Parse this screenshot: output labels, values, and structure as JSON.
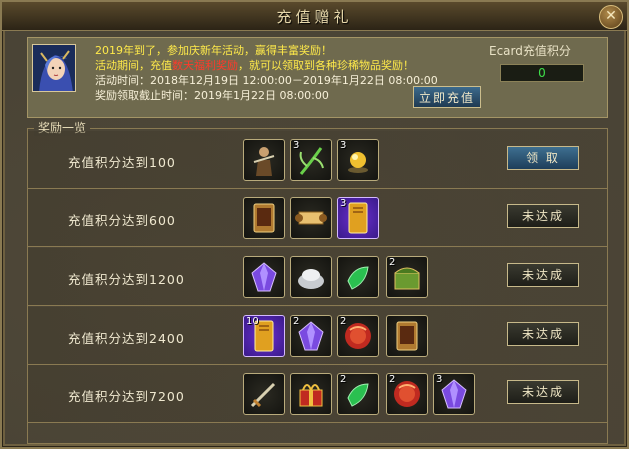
{
  "window": {
    "title": "充值赠礼"
  },
  "notice": {
    "line1": "2019年到了，参加庆新年活动，赢得丰富奖励！",
    "line2_prefix": "活动期间，充值",
    "line2_highlight": "数天福利奖励",
    "line2_suffix": "，就可以领取到各种珍稀物品奖励！",
    "line3": "活动时间：2018年12月19日 12:00:00－2019年1月22日 08:00:00",
    "line4": "奖励领取截止时间：2019年1月22日 08:00:00"
  },
  "ecard": {
    "label": "Ecard充值积分",
    "value": "0"
  },
  "recharge_button": "立即充值",
  "section_title": "奖励一览",
  "tiers": [
    {
      "label": "充值积分达到100",
      "action": "领 取",
      "items": [
        {
          "icon": "warrior-figure-icon",
          "count": ""
        },
        {
          "icon": "herb-icon",
          "count": "3"
        },
        {
          "icon": "golden-orb-icon",
          "count": "3"
        }
      ]
    },
    {
      "label": "充值积分达到600",
      "action": "未达成",
      "items": [
        {
          "icon": "skill-book-icon",
          "count": ""
        },
        {
          "icon": "scroll-icon",
          "count": ""
        },
        {
          "icon": "gold-book-icon",
          "count": "3"
        }
      ]
    },
    {
      "label": "充值积分达到1200",
      "action": "未达成",
      "items": [
        {
          "icon": "purple-gem-icon",
          "count": ""
        },
        {
          "icon": "silver-ingot-icon",
          "count": ""
        },
        {
          "icon": "jade-icon",
          "count": ""
        },
        {
          "icon": "treasure-chest-icon",
          "count": "2"
        }
      ]
    },
    {
      "label": "充值积分达到2400",
      "action": "未达成",
      "items": [
        {
          "icon": "gold-book-icon",
          "count": "10"
        },
        {
          "icon": "purple-gem-icon",
          "count": "2"
        },
        {
          "icon": "red-orb-icon",
          "count": "2"
        },
        {
          "icon": "skill-book-icon",
          "count": ""
        }
      ]
    },
    {
      "label": "充值积分达到7200",
      "action": "未达成",
      "items": [
        {
          "icon": "sword-icon",
          "count": ""
        },
        {
          "icon": "gift-box-icon",
          "count": ""
        },
        {
          "icon": "jade-icon",
          "count": "2"
        },
        {
          "icon": "red-orb-icon",
          "count": "2"
        },
        {
          "icon": "purple-gem-icon",
          "count": "3"
        }
      ]
    }
  ],
  "colors": {
    "accent_gold": "#e6d7aa",
    "notice_yellow": "#ffea4a",
    "highlight_red": "#ff3a2a",
    "score_green": "#3ee04a"
  }
}
